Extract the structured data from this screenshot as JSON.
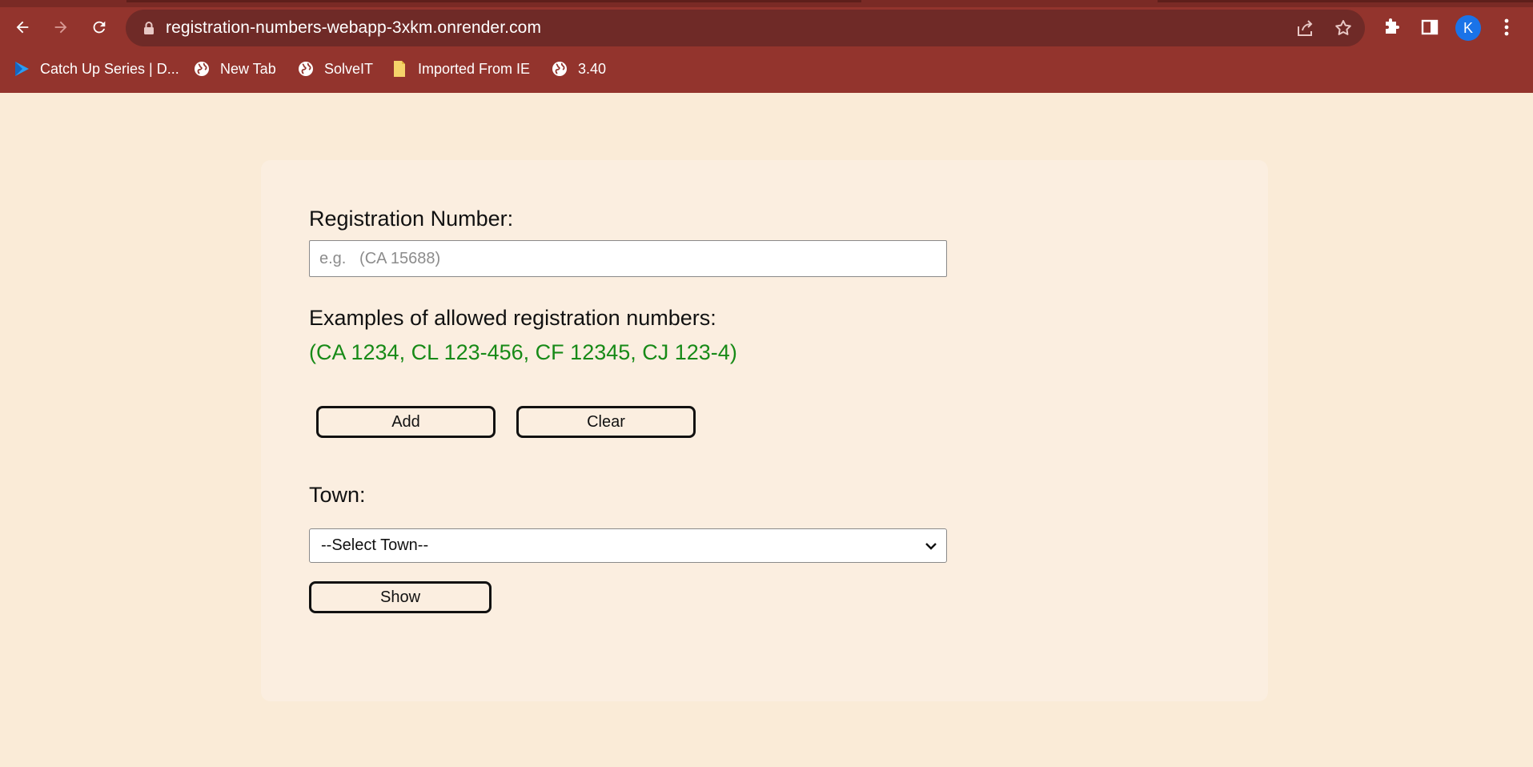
{
  "browser": {
    "url": "registration-numbers-webapp-3xkm.onrender.com",
    "profile_initial": "K",
    "bookmarks": [
      {
        "label": "Catch Up Series | D...",
        "icon": "play-logo-icon"
      },
      {
        "label": "New Tab",
        "icon": "globe-icon"
      },
      {
        "label": "SolveIT",
        "icon": "globe-icon"
      },
      {
        "label": "Imported From IE",
        "icon": "folder-icon"
      },
      {
        "label": "3.40",
        "icon": "globe-icon"
      }
    ],
    "colors": {
      "toolbar": "#93342d",
      "omnibox": "#6f2a27",
      "avatar": "#1a73e8"
    }
  },
  "page": {
    "reg_label": "Registration Number:",
    "reg_placeholder": "e.g.   (CA 15688)",
    "examples_label": "Examples of allowed registration numbers:",
    "examples_text": "(CA 1234, CL 123-456, CF 12345, CJ 123-4)",
    "add_label": "Add",
    "clear_label": "Clear",
    "town_label": "Town:",
    "town_selected": "--Select Town--",
    "show_label": "Show",
    "colors": {
      "background": "#faebd7",
      "examples": "#178a17"
    }
  }
}
